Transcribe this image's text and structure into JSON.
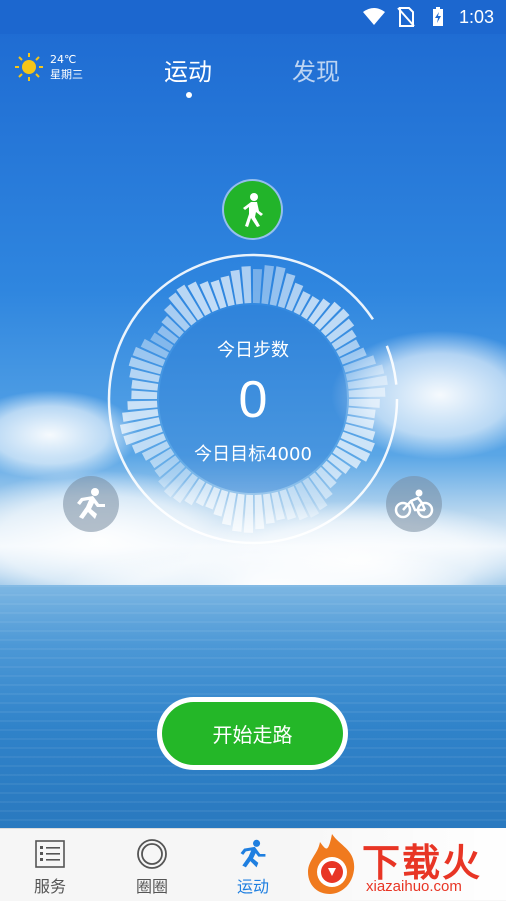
{
  "status_bar": {
    "time": "1:03"
  },
  "weather": {
    "temperature": "24℃",
    "weekday": "星期三",
    "icon": "sun-icon"
  },
  "tabs": [
    {
      "label": "运动",
      "active": true
    },
    {
      "label": "发现",
      "active": false
    }
  ],
  "step_ring": {
    "label": "今日步数",
    "count": "0",
    "goal": "今日目标4000"
  },
  "modes": {
    "walk": "walk-icon",
    "run": "run-icon",
    "bike": "bike-icon"
  },
  "start_button": {
    "label": "开始走路"
  },
  "bottom_nav": [
    {
      "label": "服务",
      "icon": "list-icon",
      "active": false
    },
    {
      "label": "圈圈",
      "icon": "circle-icon",
      "active": false
    },
    {
      "label": "运动",
      "icon": "runner-icon",
      "active": true
    }
  ],
  "watermark": {
    "title": "下载火",
    "url": "xiazaihuo.com"
  },
  "colors": {
    "accent_green": "#24b728",
    "active_blue": "#1f7fe0",
    "watermark_red": "#e83525"
  }
}
